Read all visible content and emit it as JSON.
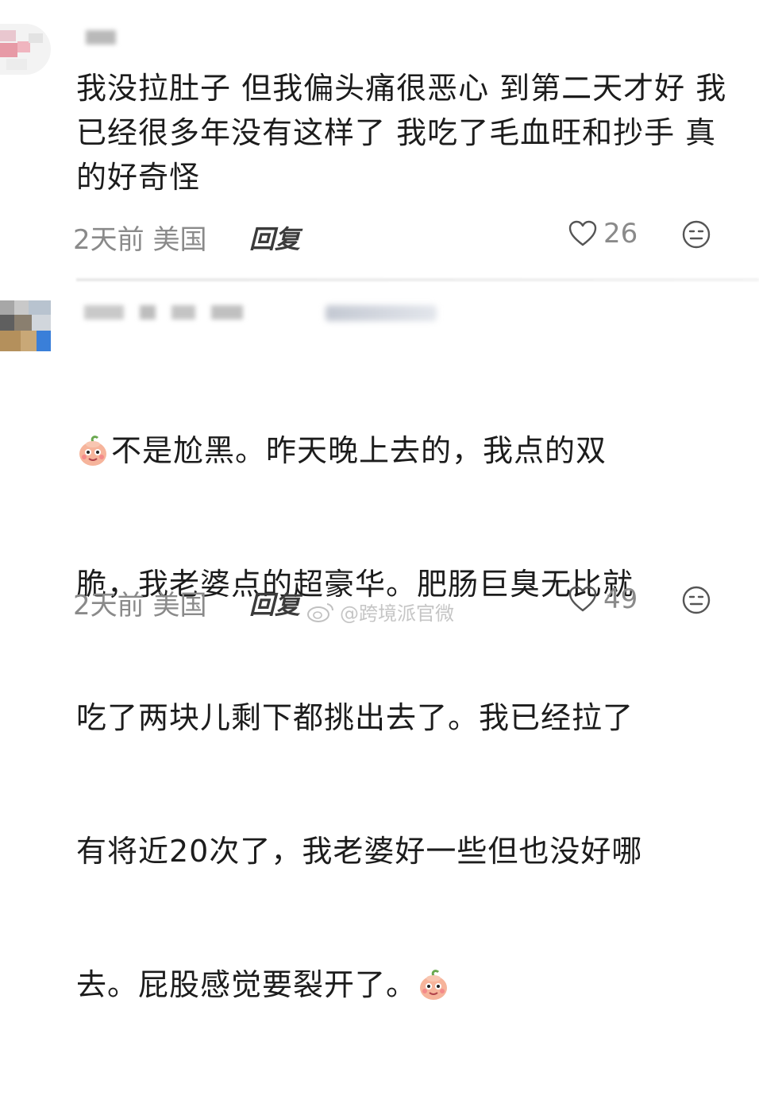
{
  "comments": [
    {
      "text": "我没拉肚子 但我偏头痛很恶心 到第二天才好 我已经很多年没有这样了 我吃了毛血旺和抄手 真的好奇怪",
      "time_location": "2天前 美国",
      "reply_label": "回复",
      "likes": "26"
    },
    {
      "text_lines": [
        "不是尬黑。昨天晚上去的，我点的双",
        "脆，我老婆点的超豪华。肥肠巨臭无比就",
        "吃了两块儿剩下都挑出去了。我已经拉了",
        "有将近20次了，我老婆好一些但也没好哪",
        "去。屁股感觉要裂开了。"
      ],
      "time_location": "2天前 美国",
      "reply_label": "回复",
      "likes": "49"
    }
  ],
  "icons": {
    "like": "heart-outline-icon",
    "more": "neutral-face-icon",
    "emoji": "peach-face-emoji-icon",
    "watermark": "weibo-logo-icon"
  },
  "watermark": "@跨境派官微",
  "colors": {
    "text": "#1c1c1c",
    "meta": "#8a8a8a"
  }
}
